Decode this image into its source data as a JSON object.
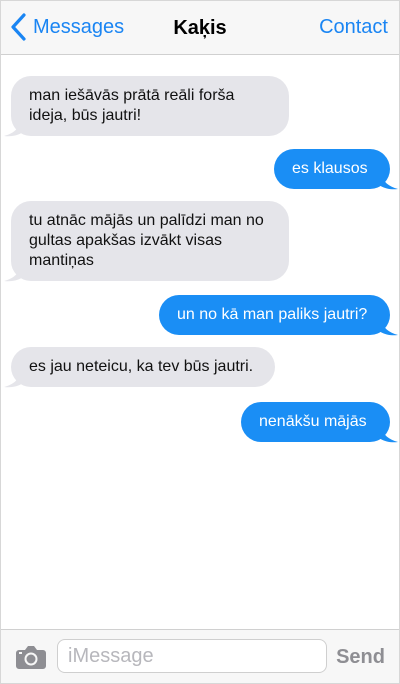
{
  "header": {
    "back_label": "Messages",
    "title": "Kaķis",
    "contact_label": "Contact"
  },
  "messages": [
    {
      "direction": "incoming",
      "text": "man iešāvās prātā reāli forša ideja, būs jautri!"
    },
    {
      "direction": "outgoing",
      "text": "es klausos"
    },
    {
      "direction": "incoming",
      "text": "tu atnāc mājās un palīdzi man no gultas apakšas izvākt visas mantiņas"
    },
    {
      "direction": "outgoing",
      "text": "un no kā man paliks jautri?"
    },
    {
      "direction": "incoming",
      "text": "es jau neteicu, ka tev būs jautri."
    },
    {
      "direction": "outgoing",
      "text": "nenākšu mājās"
    }
  ],
  "input": {
    "placeholder": "iMessage",
    "send_label": "Send"
  },
  "colors": {
    "accent": "#1a85f3",
    "incoming_bubble": "#e5e5ea",
    "outgoing_bubble": "#1a8ef5",
    "bar_background": "#f7f7f7"
  },
  "icons": {
    "back": "chevron-left-icon",
    "camera": "camera-icon"
  }
}
